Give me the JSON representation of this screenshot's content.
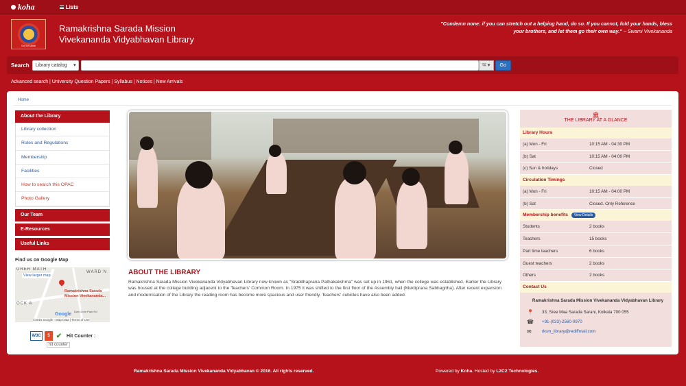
{
  "topbar": {
    "logo": "koha",
    "lists_label": "Lists"
  },
  "header": {
    "library_name_line1": "Ramakrishna Sarada Mission",
    "library_name_line2": "Vivekananda Vidyabhavan Library",
    "emblem_caption": "Sri Sri Math",
    "quote": "\"Condemn none: if you can stretch out a helping hand, do so. If you cannot, fold your hands, bless your brothers, and let them go their own way.\"",
    "quote_author": "~ Swami Vivekananda"
  },
  "search": {
    "label": "Search",
    "select_value": "Library catalog",
    "kbd_label": "অ ▾",
    "go_label": "Go"
  },
  "links": [
    "Advanced search",
    "University Question Papers",
    "Syllabus",
    "Notices",
    "New Arrivals"
  ],
  "breadcrumb": "Home",
  "sidebar": {
    "about_head": "About the Library",
    "items": [
      "Library collection",
      "Rules and Regulations",
      "Membership",
      "Facilities",
      "How to search this OPAC",
      "Photo Gallery"
    ],
    "team_head": "Our Team",
    "eres_head": "E-Resources",
    "useful_head": "Useful Links"
  },
  "map": {
    "title": "Find us on Google Map",
    "link": "View larger map",
    "label_top": "URER MATH",
    "label_ward": "WARD N",
    "label_lock": "OCK A",
    "place": "Ramakrishna Sarada Mission Vivekananda...",
    "google": "Google",
    "footer": "©2016 Google - Map Data | Terms of Use",
    "road_label": "Dum Dum Park Rd"
  },
  "badges": {
    "w3c": "W3C",
    "html5": "5",
    "hit_counter": "Hit Counter :",
    "hit_img_alt": "hit counter"
  },
  "about": {
    "title": "ABOUT THE LIBRARY",
    "text": "Ramakrishna Sarada Mission Vivekananda Vidyabhavan Library now known as \"Sraddhaprana Pathakakshma\" was set up in 1961, when the college was established. Earlier the Library was housed at the college building adjacent to the Teachers' Common Room. In 1975 it was shifted to the first floor of the Assembly hall (Muktiprana Sabhagriha). After recent expansion and modernisation of the Library the reading room has become more spacious and user friendly. Teachers' cubicles have also been added."
  },
  "glance": {
    "title": "THE LIBRARY AT A GLANCE",
    "hours_head": "Library Hours",
    "hours": [
      {
        "k": "(a) Mon - Fri",
        "v": "10:15 AM - 04:30 PM"
      },
      {
        "k": "(b) Sat",
        "v": "10:15 AM - 04:00 PM"
      },
      {
        "k": "(c) Sun & holidays",
        "v": "Closed"
      }
    ],
    "circ_head": "Circulation Timings",
    "circ": [
      {
        "k": "(a) Mon - Fri",
        "v": "10:15 AM - 04:00 PM"
      },
      {
        "k": "(b) Sat",
        "v": "Closed. Only Reference"
      }
    ],
    "member_head": "Membership benefits",
    "view_details": "View Details",
    "members": [
      {
        "k": "Students",
        "v": "2 books"
      },
      {
        "k": "Teachers",
        "v": "15 books"
      },
      {
        "k": "Part time teachers",
        "v": "6 books"
      },
      {
        "k": "Guest teachers",
        "v": "2 books"
      },
      {
        "k": "Others",
        "v": "2 books"
      }
    ],
    "contact_head": "Contact Us",
    "contact_name": "Ramakrishna Sarada Mission Vivekananda Vidyabhavan Library",
    "address": "33, Sree Maa Sarada Sarani, Kolkata 700 055",
    "phone": "+91-(033)-2560-0970",
    "email": "rksm_library@rediffmail.com"
  },
  "footer": {
    "left": "Ramakrishna Sarada Mission Vivekananda Vidyabhavan © 2016. All rights reserved.",
    "powered_prefix": "Powered by",
    "koha": "Koha",
    "hosted_prefix": ". Hosted by",
    "host": "L2C2 Technologies",
    "end": "."
  }
}
